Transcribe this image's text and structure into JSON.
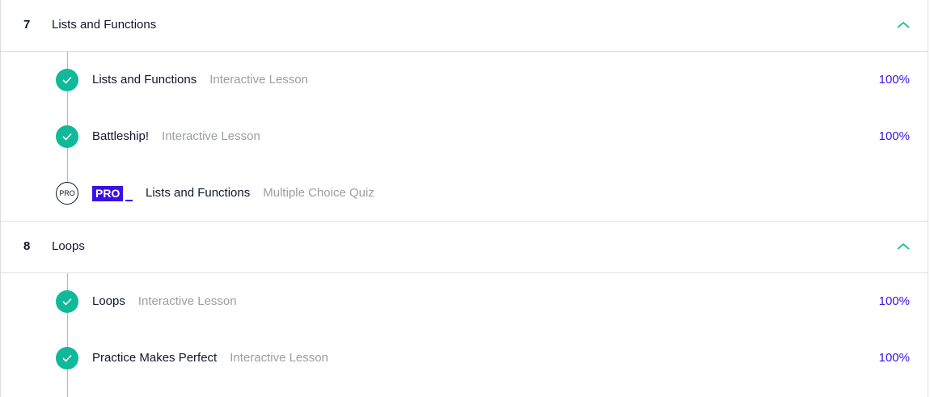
{
  "modules": [
    {
      "number": "7",
      "title": "Lists and Functions",
      "items": [
        {
          "title": "Lists and Functions",
          "type": "Interactive Lesson",
          "progress": "100%",
          "completed": true,
          "pro": false
        },
        {
          "title": "Battleship!",
          "type": "Interactive Lesson",
          "progress": "100%",
          "completed": true,
          "pro": false
        },
        {
          "title": "Lists and Functions",
          "type": "Multiple Choice Quiz",
          "progress": "",
          "completed": false,
          "pro": true,
          "pro_circle_label": "PRO",
          "pro_badge_label": "PRO"
        }
      ]
    },
    {
      "number": "8",
      "title": "Loops",
      "items": [
        {
          "title": "Loops",
          "type": "Interactive Lesson",
          "progress": "100%",
          "completed": true,
          "pro": false
        },
        {
          "title": "Practice Makes Perfect",
          "type": "Interactive Lesson",
          "progress": "100%",
          "completed": true,
          "pro": false
        }
      ]
    }
  ],
  "colors": {
    "accent": "#3a10e5",
    "complete": "#0fb99a",
    "chevron": "#0fb99a",
    "text": "#10162f",
    "muted": "#9a9da6",
    "border": "#d9dde3"
  },
  "icons": {
    "collapse": "chevron-up-icon",
    "completed": "checkmark-icon",
    "locked": "pro-circle-icon"
  }
}
